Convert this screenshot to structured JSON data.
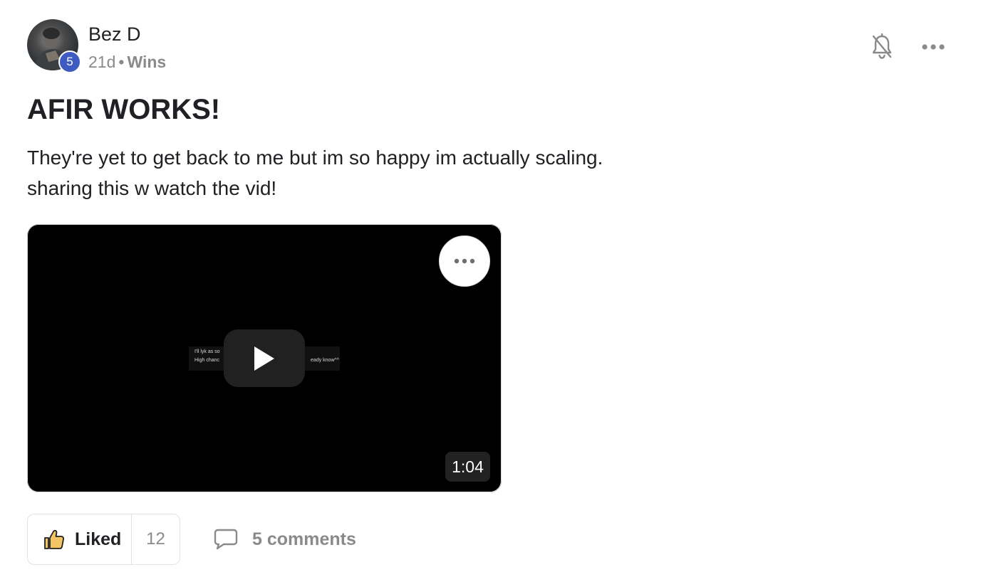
{
  "author": {
    "name": "Bez D",
    "level": "5",
    "time_ago": "21d",
    "separator": "•",
    "category": "Wins"
  },
  "header_actions": {
    "bell_icon": "bell-off-icon",
    "more_icon": "more-horizontal-icon"
  },
  "post": {
    "title": "AFIR WORKS!",
    "body_lines": [
      "They're yet to get back to me but im so happy im actually scaling.",
      "sharing this w watch the vid!"
    ]
  },
  "video": {
    "duration": "1:04",
    "caption_lines": [
      "I'll lyk as so",
      "High chanc",
      "eady know^^"
    ],
    "play_icon": "play-icon",
    "menu_icon": "more-horizontal-icon"
  },
  "actions": {
    "like_label": "Liked",
    "like_count": "12",
    "comments_label": "5 comments",
    "like_icon": "thumbs-up-icon",
    "comment_icon": "comment-icon"
  },
  "colors": {
    "level_badge": "#3d5bc1",
    "like_icon_fill": "#f2c464",
    "muted_text": "#8a8a8a",
    "video_bg": "#000000"
  }
}
